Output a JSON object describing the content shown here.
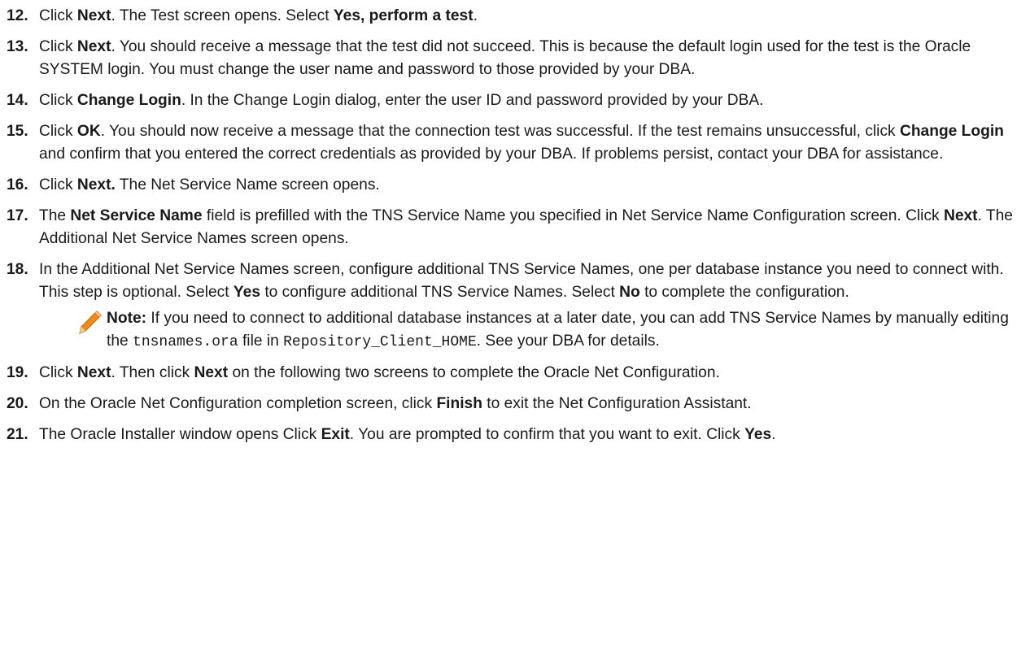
{
  "steps": [
    {
      "num": "12.",
      "parts": [
        {
          "t": "Click "
        },
        {
          "t": "Next",
          "b": true
        },
        {
          "t": ". The Test screen opens. Select "
        },
        {
          "t": "Yes, perform a test",
          "b": true
        },
        {
          "t": "."
        }
      ]
    },
    {
      "num": "13.",
      "parts": [
        {
          "t": "Click "
        },
        {
          "t": "Next",
          "b": true
        },
        {
          "t": ". You should receive a message that the test did not succeed. This is because the default login used for the test is the Oracle SYSTEM login. You must change the user name and password to those provided by your DBA."
        }
      ]
    },
    {
      "num": "14.",
      "parts": [
        {
          "t": "Click "
        },
        {
          "t": "Change Login",
          "b": true
        },
        {
          "t": ". In the Change Login dialog, enter the user ID and password provided by your DBA."
        }
      ]
    },
    {
      "num": "15.",
      "parts": [
        {
          "t": "Click "
        },
        {
          "t": "OK",
          "b": true
        },
        {
          "t": ". You should now receive a message that the connection test was successful. If the test remains unsuccessful, click "
        },
        {
          "t": "Change Login",
          "b": true
        },
        {
          "t": " and confirm that you entered the correct credentials as provided by your DBA. If problems persist, contact your DBA for assistance."
        }
      ]
    },
    {
      "num": "16.",
      "parts": [
        {
          "t": "Click "
        },
        {
          "t": "Next.",
          "b": true
        },
        {
          "t": " The Net Service Name screen opens."
        }
      ]
    },
    {
      "num": "17.",
      "parts": [
        {
          "t": "The "
        },
        {
          "t": "Net Service Name",
          "b": true
        },
        {
          "t": " field is prefilled with the TNS Service Name you specified in Net Service Name Configuration screen. Click "
        },
        {
          "t": "Next",
          "b": true
        },
        {
          "t": ". The Additional Net Service Names screen opens."
        }
      ]
    },
    {
      "num": "18.",
      "parts": [
        {
          "t": "In the Additional Net Service Names screen, configure additional TNS Service Names, one per database instance you need to connect with. This step is optional. Select "
        },
        {
          "t": "Yes",
          "b": true
        },
        {
          "t": " to configure additional TNS Service Names. Select "
        },
        {
          "t": "No",
          "b": true
        },
        {
          "t": " to complete the configuration."
        }
      ],
      "note": {
        "icon": "pencil-note-icon",
        "parts": [
          {
            "t": "Note:",
            "b": true
          },
          {
            "t": " If you need to connect to additional database instances at a later date, you can add TNS Service Names by manually editing the "
          },
          {
            "t": "tnsnames.ora",
            "m": true
          },
          {
            "t": " file in "
          },
          {
            "t": "Repository_Client_HOME",
            "m": true
          },
          {
            "t": ". See your DBA for details."
          }
        ]
      }
    },
    {
      "num": "19.",
      "parts": [
        {
          "t": "Click "
        },
        {
          "t": "Next",
          "b": true
        },
        {
          "t": ". Then click "
        },
        {
          "t": "Next",
          "b": true
        },
        {
          "t": " on the following two screens to complete the Oracle Net Configuration."
        }
      ]
    },
    {
      "num": "20.",
      "parts": [
        {
          "t": "On the Oracle Net Configuration completion screen, click "
        },
        {
          "t": "Finish",
          "b": true
        },
        {
          "t": " to exit the Net Configuration Assistant."
        }
      ]
    },
    {
      "num": "21.",
      "parts": [
        {
          "t": "The Oracle Installer window opens Click "
        },
        {
          "t": "Exit",
          "b": true
        },
        {
          "t": ". You are prompted to confirm that you want to exit. Click "
        },
        {
          "t": "Yes",
          "b": true
        },
        {
          "t": "."
        }
      ]
    }
  ],
  "colors": {
    "text": "#1a1a1a",
    "note_icon_body": "#f28a1a",
    "note_icon_tip": "#f7c98b"
  }
}
